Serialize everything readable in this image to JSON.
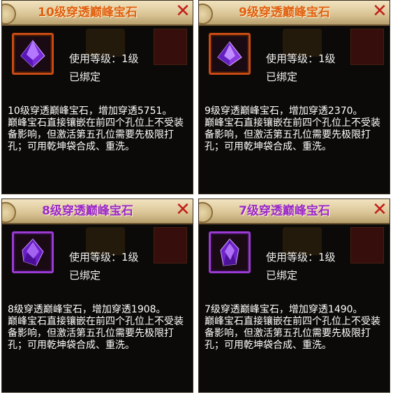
{
  "colors": {
    "title_orange": "#e06010",
    "title_purple": "#9a28c8",
    "frame_orange": "#c94a12",
    "frame_purple": "#9b3bd4",
    "gem": "#7a2bd8"
  },
  "tooltips": [
    {
      "title": "10级穿透巅峰宝石",
      "level_label": "使用等级：1级",
      "bound_label": "已绑定",
      "desc_line1": "10级穿透巅峰宝石，增加穿透5751。",
      "desc_line2": "巅峰宝石直接镶嵌在前四个孔位上不受装备影响，但激活第五孔位需要先极限打孔；可用乾坤袋合成、重洗。",
      "close_icon": "close-x-icon",
      "gem_icon": "purple-gem-icon"
    },
    {
      "title": "9级穿透巅峰宝石",
      "level_label": "使用等级：1级",
      "bound_label": "已绑定",
      "desc_line1": "9级穿透巅峰宝石，增加穿透2370。",
      "desc_line2": "巅峰宝石直接镶嵌在前四个孔位上不受装备影响，但激活第五孔位需要先极限打孔；可用乾坤袋合成、重洗。",
      "close_icon": "close-x-icon",
      "gem_icon": "purple-gem-icon"
    },
    {
      "title": "8级穿透巅峰宝石",
      "level_label": "使用等级：1级",
      "bound_label": "已绑定",
      "desc_line1": "8级穿透巅峰宝石，增加穿透1908。",
      "desc_line2": "巅峰宝石直接镶嵌在前四个孔位上不受装备影响，但激活第五孔位需要先极限打孔；可用乾坤袋合成、重洗。",
      "close_icon": "close-x-icon",
      "gem_icon": "purple-gem-icon"
    },
    {
      "title": "7级穿透巅峰宝石",
      "level_label": "使用等级：1级",
      "bound_label": "已绑定",
      "desc_line1": "7级穿透巅峰宝石，增加穿透1490。",
      "desc_line2": "巅峰宝石直接镶嵌在前四个孔位上不受装备影响，但激活第五孔位需要先极限打孔；可用乾坤袋合成、重洗。",
      "close_icon": "close-x-icon",
      "gem_icon": "purple-gem-icon"
    }
  ]
}
